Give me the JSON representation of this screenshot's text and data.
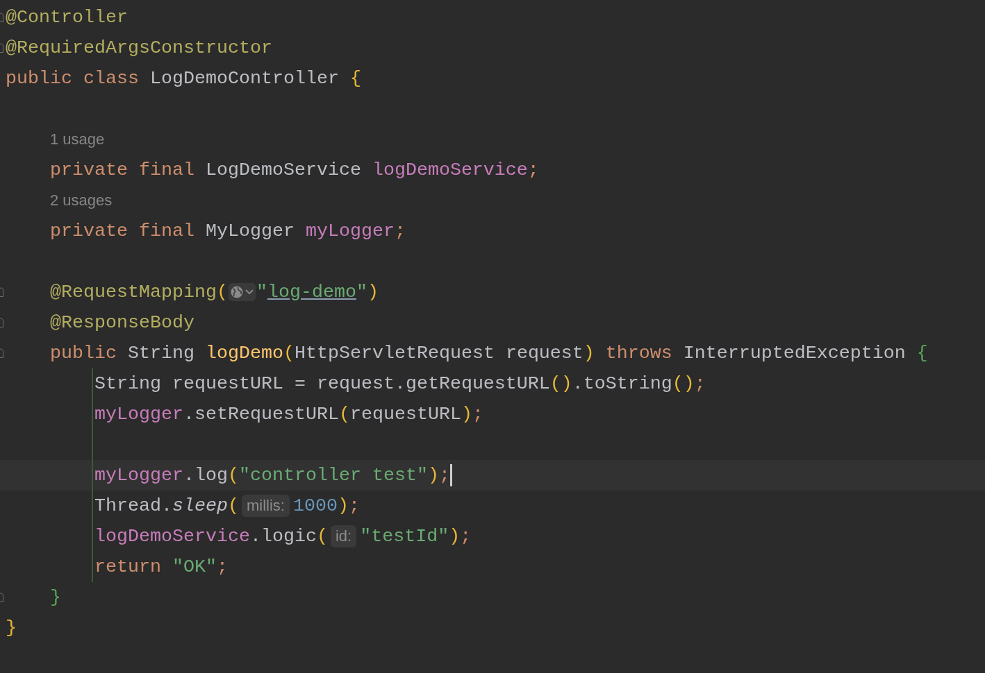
{
  "lines": [
    {
      "kind": "code",
      "fold": true,
      "tokens": [
        {
          "text": "@Controller",
          "kind": "ann"
        }
      ]
    },
    {
      "kind": "code",
      "fold": true,
      "tokens": [
        {
          "text": "@RequiredArgsConstructor",
          "kind": "ann"
        }
      ]
    },
    {
      "kind": "code",
      "fold": false,
      "scope_guide": false,
      "tokens": [
        {
          "text": "public class ",
          "kind": "kw"
        },
        {
          "text": "LogDemoController ",
          "kind": "plain"
        },
        {
          "text": "{",
          "kind": "by"
        }
      ],
      "children": [
        {
          "kind": "blank"
        },
        {
          "kind": "usage",
          "text": "1 usage"
        },
        {
          "kind": "code",
          "fold": false,
          "tokens": [
            {
              "text": "private final ",
              "kind": "kw"
            },
            {
              "text": "LogDemoService ",
              "kind": "plain"
            },
            {
              "text": "logDemoService",
              "kind": "field"
            },
            {
              "text": ";",
              "kind": "kw"
            }
          ]
        },
        {
          "kind": "usage",
          "text": "2 usages"
        },
        {
          "kind": "code",
          "fold": false,
          "tokens": [
            {
              "text": "private final ",
              "kind": "kw"
            },
            {
              "text": "MyLogger ",
              "kind": "plain"
            },
            {
              "text": "myLogger",
              "kind": "field"
            },
            {
              "text": ";",
              "kind": "kw"
            }
          ]
        },
        {
          "kind": "blank"
        },
        {
          "kind": "code",
          "fold": true,
          "tokens": [
            {
              "text": "@RequestMapping",
              "kind": "ann"
            },
            {
              "text": "(",
              "kind": "by"
            },
            {
              "kind": "globe"
            },
            {
              "text": "\"",
              "kind": "str"
            },
            {
              "text": "log-demo",
              "kind": "link"
            },
            {
              "text": "\"",
              "kind": "str"
            },
            {
              "text": ")",
              "kind": "by"
            }
          ]
        },
        {
          "kind": "code",
          "fold": true,
          "tokens": [
            {
              "text": "@ResponseBody",
              "kind": "ann"
            }
          ]
        },
        {
          "kind": "code",
          "fold": true,
          "scope_guide": true,
          "tokens": [
            {
              "text": "public ",
              "kind": "kw"
            },
            {
              "text": "String ",
              "kind": "plain"
            },
            {
              "text": "logDemo",
              "kind": "method"
            },
            {
              "text": "(",
              "kind": "by"
            },
            {
              "text": "HttpServletRequest request",
              "kind": "plain"
            },
            {
              "text": ")",
              "kind": "by"
            },
            {
              "text": " throws ",
              "kind": "kw"
            },
            {
              "text": "InterruptedException ",
              "kind": "plain"
            },
            {
              "text": "{",
              "kind": "bg"
            }
          ],
          "children": [
            {
              "kind": "code",
              "fold": false,
              "tokens": [
                {
                  "text": "String requestURL = request.getRequestURL",
                  "kind": "plain"
                },
                {
                  "text": "()",
                  "kind": "by"
                },
                {
                  "text": ".toString",
                  "kind": "plain"
                },
                {
                  "text": "()",
                  "kind": "by"
                },
                {
                  "text": ";",
                  "kind": "kw"
                }
              ]
            },
            {
              "kind": "code",
              "fold": false,
              "tokens": [
                {
                  "text": "myLogger",
                  "kind": "field"
                },
                {
                  "text": ".setRequestURL",
                  "kind": "plain"
                },
                {
                  "text": "(",
                  "kind": "by"
                },
                {
                  "text": "requestURL",
                  "kind": "plain"
                },
                {
                  "text": ")",
                  "kind": "by"
                },
                {
                  "text": ";",
                  "kind": "kw"
                }
              ]
            },
            {
              "kind": "blank"
            },
            {
              "kind": "code",
              "fold": false,
              "tokens": [
                {
                  "text": "myLogger",
                  "kind": "field"
                },
                {
                  "text": ".log",
                  "kind": "plain"
                },
                {
                  "text": "(",
                  "kind": "by"
                },
                {
                  "text": "\"controller test\"",
                  "kind": "str"
                },
                {
                  "text": ")",
                  "kind": "by"
                },
                {
                  "text": ";",
                  "kind": "kw"
                },
                {
                  "kind": "caret"
                }
              ]
            },
            {
              "kind": "code",
              "fold": false,
              "tokens": [
                {
                  "text": "Thread.",
                  "kind": "plain"
                },
                {
                  "text": "sleep",
                  "kind": "italic"
                },
                {
                  "text": "(",
                  "kind": "by"
                },
                {
                  "text": "millis:",
                  "kind": "hint"
                },
                {
                  "text": "1000",
                  "kind": "num"
                },
                {
                  "text": ")",
                  "kind": "by"
                },
                {
                  "text": ";",
                  "kind": "kw"
                }
              ]
            },
            {
              "kind": "code",
              "fold": false,
              "tokens": [
                {
                  "text": "logDemoService",
                  "kind": "field"
                },
                {
                  "text": ".logic",
                  "kind": "plain"
                },
                {
                  "text": "(",
                  "kind": "by"
                },
                {
                  "text": "id:",
                  "kind": "hint"
                },
                {
                  "text": "\"testId\"",
                  "kind": "str"
                },
                {
                  "text": ")",
                  "kind": "by"
                },
                {
                  "text": ";",
                  "kind": "kw"
                }
              ]
            },
            {
              "kind": "code",
              "fold": false,
              "tokens": [
                {
                  "text": "return ",
                  "kind": "kw"
                },
                {
                  "text": "\"OK\"",
                  "kind": "str"
                },
                {
                  "text": ";",
                  "kind": "kw"
                }
              ]
            }
          ]
        },
        {
          "kind": "code",
          "fold": true,
          "tokens": [
            {
              "text": "}",
              "kind": "bg"
            }
          ]
        }
      ]
    },
    {
      "kind": "code",
      "fold": false,
      "tokens": [
        {
          "text": "}",
          "kind": "by"
        }
      ]
    }
  ]
}
